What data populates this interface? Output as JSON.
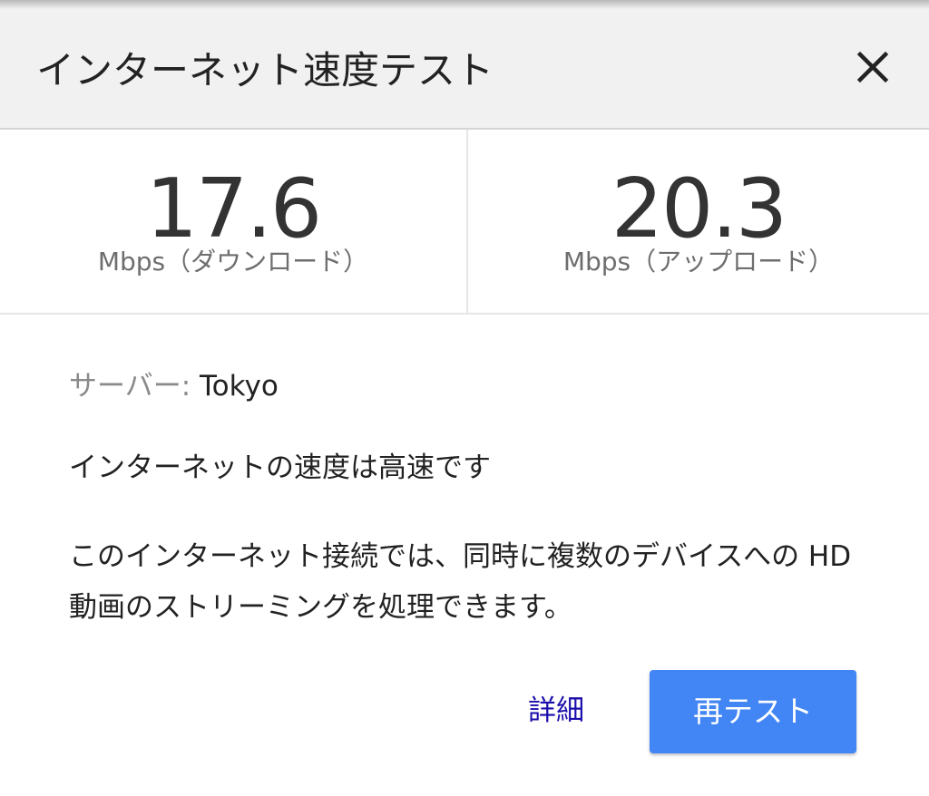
{
  "header": {
    "title": "インターネット速度テスト",
    "close_icon": "close-icon"
  },
  "results": {
    "download": {
      "value": "17.6",
      "unit_label": "Mbps（ダウンロード）"
    },
    "upload": {
      "value": "20.3",
      "unit_label": "Mbps（アップロード）"
    }
  },
  "info": {
    "server_label": "サーバー: ",
    "server_value": "Tokyo",
    "summary": "インターネットの速度は高速です",
    "description": "このインターネット接続では、同時に複数のデバイスへの HD 動画のストリーミングを処理できます。"
  },
  "actions": {
    "details_label": "詳細",
    "retest_label": "再テスト"
  },
  "colors": {
    "header_bg": "#f1f1f1",
    "primary_button": "#4285f4",
    "link": "#1a0dab"
  }
}
